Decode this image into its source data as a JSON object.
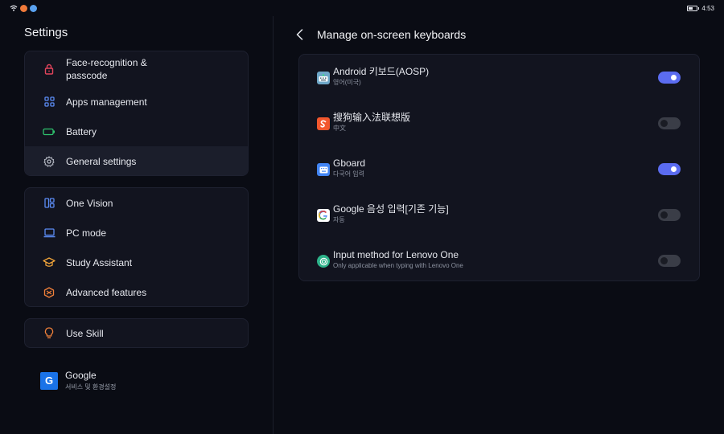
{
  "status_bar": {
    "time": "4:53"
  },
  "left": {
    "title": "Settings",
    "group1": [
      {
        "label": "Face-recognition &\npasscode",
        "icon": "lock-icon"
      },
      {
        "label": "Apps management",
        "icon": "apps-grid-icon"
      },
      {
        "label": "Battery",
        "icon": "battery-icon"
      },
      {
        "label": "General settings",
        "icon": "gear-icon",
        "active": true
      }
    ],
    "group2": [
      {
        "label": "One Vision",
        "icon": "one-vision-icon"
      },
      {
        "label": "PC mode",
        "icon": "laptop-icon"
      },
      {
        "label": "Study Assistant",
        "icon": "graduation-cap-icon"
      },
      {
        "label": "Advanced features",
        "icon": "advanced-features-icon"
      }
    ],
    "group3": [
      {
        "label": "Use Skill",
        "icon": "lightbulb-icon"
      }
    ],
    "google": {
      "title": "Google",
      "subtitle": "서비스 및 환경설정",
      "logo_letter": "G"
    }
  },
  "right": {
    "title": "Manage on-screen keyboards",
    "keyboards": [
      {
        "title": "Android 키보드(AOSP)",
        "subtitle": "영어(미국)",
        "enabled": true,
        "icon": "android-keyboard-icon",
        "icon_color": "#6ea7c8"
      },
      {
        "title": "搜狗输入法联想版",
        "subtitle": "中文",
        "enabled": false,
        "icon": "sogou-icon",
        "icon_color": "#f2572d"
      },
      {
        "title": "Gboard",
        "subtitle": "다국어 입력",
        "enabled": true,
        "icon": "gboard-icon",
        "icon_color": "#4285f4"
      },
      {
        "title": "Google 음성 입력[기존 기능]",
        "subtitle": "자동",
        "enabled": false,
        "icon": "google-voice-icon",
        "icon_color": "#ffffff"
      },
      {
        "title": "Input method for Lenovo One",
        "subtitle": "Only applicable when typing with Lenovo One",
        "enabled": false,
        "icon": "lenovo-one-icon",
        "icon_color": "#2db38a"
      }
    ]
  },
  "colors": {
    "accent": "#5b6cf0",
    "background": "#0a0c14",
    "card": "#12141f"
  }
}
